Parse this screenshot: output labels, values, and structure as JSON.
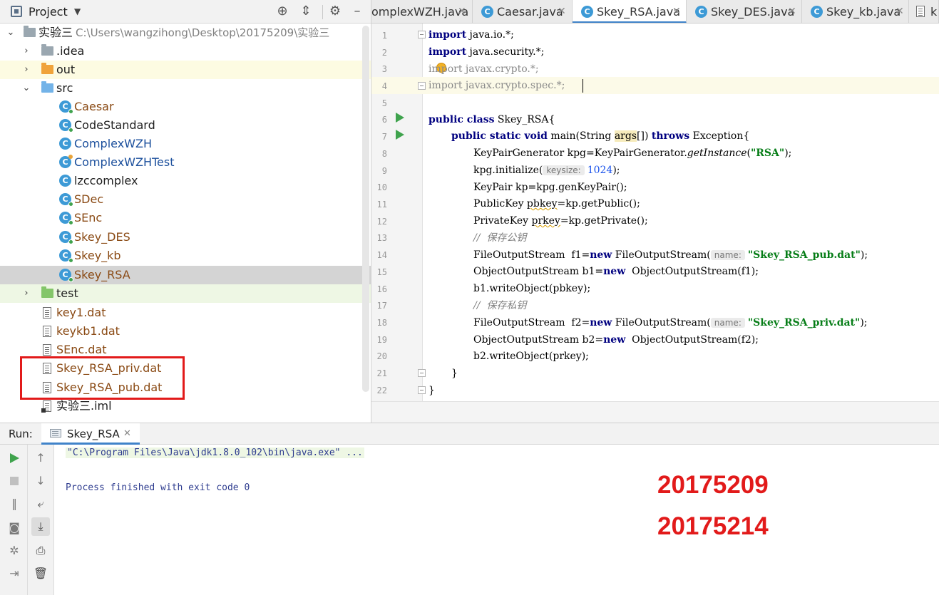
{
  "project_panel": {
    "title": "Project",
    "tree": [
      {
        "label": "实验三",
        "path": "C:\\Users\\wangzihong\\Desktop\\20175209\\实验三",
        "kind": "project",
        "expanded": true
      },
      {
        "label": ".idea",
        "kind": "folder-grey",
        "expanded": false
      },
      {
        "label": "out",
        "kind": "folder-orange",
        "expanded": false
      },
      {
        "label": "src",
        "kind": "folder-blue",
        "expanded": true
      },
      {
        "label": "Caesar",
        "kind": "class"
      },
      {
        "label": "CodeStandard",
        "kind": "class"
      },
      {
        "label": "ComplexWZH",
        "kind": "class"
      },
      {
        "label": "ComplexWZHTest",
        "kind": "class"
      },
      {
        "label": "lzccomplex",
        "kind": "class"
      },
      {
        "label": "SDec",
        "kind": "class"
      },
      {
        "label": "SEnc",
        "kind": "class"
      },
      {
        "label": "Skey_DES",
        "kind": "class"
      },
      {
        "label": "Skey_kb",
        "kind": "class"
      },
      {
        "label": "Skey_RSA",
        "kind": "class",
        "selected": true
      },
      {
        "label": "test",
        "kind": "folder-green",
        "expanded": false
      },
      {
        "label": "key1.dat",
        "kind": "file"
      },
      {
        "label": "keykb1.dat",
        "kind": "file"
      },
      {
        "label": "SEnc.dat",
        "kind": "file"
      },
      {
        "label": "Skey_RSA_priv.dat",
        "kind": "file"
      },
      {
        "label": "Skey_RSA_pub.dat",
        "kind": "file"
      },
      {
        "label": "实验三.iml",
        "kind": "iml"
      }
    ]
  },
  "editor": {
    "tabs": [
      {
        "label": "omplexWZH.java",
        "active": false
      },
      {
        "label": "Caesar.java",
        "active": false
      },
      {
        "label": "Skey_RSA.java",
        "active": true
      },
      {
        "label": "Skey_DES.java",
        "active": false
      },
      {
        "label": "Skey_kb.java",
        "active": false
      },
      {
        "label": "k",
        "active": false
      }
    ],
    "line_numbers": [
      "1",
      "2",
      "3",
      "4",
      "5",
      "6",
      "7",
      "8",
      "9",
      "10",
      "11",
      "12",
      "13",
      "14",
      "15",
      "16",
      "17",
      "18",
      "19",
      "20",
      "21",
      "22"
    ],
    "code": {
      "l1_kw": "import",
      "l1_rest": " java.io.*;",
      "l2_kw": "import",
      "l2_rest": " java.security.*;",
      "l3_text": "import javax.crypto.*;",
      "l4_text": "import javax.crypto.spec.*;",
      "l6_kw": "public class",
      "l6_rest": " Skey_RSA{",
      "l7_kw1": "public static void",
      "l7_mid": " main(String ",
      "l7_arg": "args",
      "l7_mid2": "[]) ",
      "l7_kw2": "throws",
      "l7_rest": " Exception{",
      "l8_a": "KeyPairGenerator kpg=KeyPairGenerator.",
      "l8_m": "getInstance",
      "l8_b": "(",
      "l8_s": "\"RSA\"",
      "l8_c": ");",
      "l9_a": "kpg.initialize(",
      "l9_hint": "keysize:",
      "l9_num": "1024",
      "l9_b": ");",
      "l10": "KeyPair kp=kpg.genKeyPair();",
      "l11_a": "PublicKey ",
      "l11_v": "pbkey",
      "l11_b": "=kp.getPublic();",
      "l12_a": "PrivateKey ",
      "l12_v": "prkey",
      "l12_b": "=kp.getPrivate();",
      "l13": "//  保存公钥",
      "l14_a": "FileOutputStream  f1=",
      "l14_kw": "new",
      "l14_b": " FileOutputStream(",
      "l14_hint": "name:",
      "l14_s": "\"Skey_RSA_pub.dat\"",
      "l14_c": ");",
      "l15_a": "ObjectOutputStream b1=",
      "l15_kw": "new",
      "l15_b": "  ObjectOutputStream(f1);",
      "l16": "b1.writeObject(pbkey);",
      "l17": "//  保存私钥",
      "l18_a": "FileOutputStream  f2=",
      "l18_kw": "new",
      "l18_b": " FileOutputStream(",
      "l18_hint": "name:",
      "l18_s": "\"Skey_RSA_priv.dat\"",
      "l18_c": ");",
      "l19_a": "ObjectOutputStream b2=",
      "l19_kw": "new",
      "l19_b": "  ObjectOutputStream(f2);",
      "l20": "b2.writeObject(prkey);",
      "l21": "}",
      "l22": "}"
    }
  },
  "run_panel": {
    "title": "Run:",
    "tab_label": "Skey_RSA",
    "console_cmd": "\"C:\\Program Files\\Java\\jdk1.8.0_102\\bin\\java.exe\" ...",
    "console_exit": "Process finished with exit code 0",
    "stamps": [
      "20175209",
      "20175214"
    ]
  },
  "colors": {
    "accent": "#4083c9",
    "annotation_red": "#e21a1a",
    "keyword": "#000080",
    "string": "#067d17"
  },
  "icons": {
    "header": [
      "target-icon",
      "collapse-icon",
      "gear-icon"
    ],
    "run_toolbar": [
      "play-icon",
      "stop-icon",
      "pause-icon",
      "camera-icon",
      "settings-icon",
      "login-icon"
    ],
    "run_toolbar_2": [
      "arrow-up-icon",
      "arrow-down-icon",
      "soft-wrap-icon",
      "scroll-to-end-icon",
      "print-icon",
      "trash-icon"
    ]
  }
}
